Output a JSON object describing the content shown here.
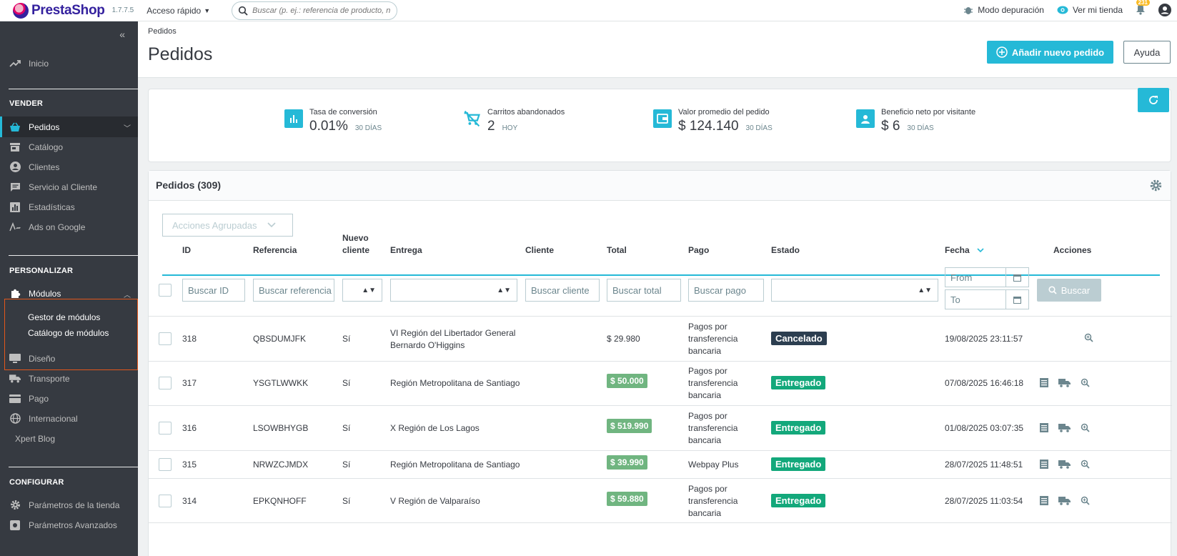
{
  "topbar": {
    "brand": "PrestaShop",
    "version": "1.7.7.5",
    "quick_access": "Acceso rápido",
    "search_placeholder": "Buscar (p. ej.: referencia de producto, n",
    "debug_mode": "Modo depuración",
    "view_store": "Ver mi tienda",
    "notifications_count": "231"
  },
  "sidebar": {
    "home": "Inicio",
    "section_sell": "VENDER",
    "orders": "Pedidos",
    "catalog": "Catálogo",
    "customers": "Clientes",
    "customer_service": "Servicio al Cliente",
    "stats": "Estadísticas",
    "ads": "Ads on Google",
    "section_customize": "PERSONALIZAR",
    "modules": "Módulos",
    "module_manager": "Gestor de módulos",
    "module_catalog": "Catálogo de módulos",
    "design": "Diseño",
    "shipping": "Transporte",
    "payment": "Pago",
    "international": "Internacional",
    "xpert_blog": "Xpert Blog",
    "section_configure": "CONFIGURAR",
    "shop_params": "Parámetros de la tienda",
    "advanced_params": "Parámetros Avanzados"
  },
  "header": {
    "breadcrumb": "Pedidos",
    "title": "Pedidos",
    "add_button": "Añadir nuevo pedido",
    "help_button": "Ayuda"
  },
  "kpis": [
    {
      "label": "Tasa de conversión",
      "value": "0.01%",
      "period": "30 DÍAS"
    },
    {
      "label": "Carritos abandonados",
      "value": "2",
      "period": "HOY"
    },
    {
      "label": "Valor promedio del pedido",
      "value": "$ 124.140",
      "period": "30 DÍAS"
    },
    {
      "label": "Beneficio neto por visitante",
      "value": "$ 6",
      "period": "30 DÍAS"
    }
  ],
  "orders": {
    "title": "Pedidos (309)",
    "bulk_actions": "Acciones Agrupadas",
    "columns": {
      "id": "ID",
      "reference": "Referencia",
      "new_customer_1": "Nuevo",
      "new_customer_2": "cliente",
      "delivery": "Entrega",
      "customer": "Cliente",
      "total": "Total",
      "payment": "Pago",
      "status": "Estado",
      "date": "Fecha",
      "actions": "Acciones"
    },
    "filters": {
      "id": "Buscar ID",
      "reference": "Buscar referencia",
      "customer": "Buscar cliente",
      "total": "Buscar total",
      "payment": "Buscar pago",
      "from": "From",
      "to": "To",
      "search_button": "Buscar"
    },
    "rows": [
      {
        "id": "318",
        "reference": "QBSDUMJFK",
        "new": "Sí",
        "delivery_1": "VI Región del Libertador General",
        "delivery_2": "Bernardo O'Higgins",
        "total": "$ 29.980",
        "pay_1": "Pagos por",
        "pay_2": "transferencia",
        "pay_3": "bancaria",
        "status": "Cancelado",
        "date": "19/08/2025 23:11:57"
      },
      {
        "id": "317",
        "reference": "YSGTLWWKK",
        "new": "Sí",
        "delivery_1": "Región Metropolitana de Santiago",
        "delivery_2": "",
        "total": "$ 50.000",
        "pay_1": "Pagos por",
        "pay_2": "transferencia",
        "pay_3": "bancaria",
        "status": "Entregado",
        "date": "07/08/2025 16:46:18"
      },
      {
        "id": "316",
        "reference": "LSOWBHYGB",
        "new": "Sí",
        "delivery_1": "X Región de Los Lagos",
        "delivery_2": "",
        "total": "$ 519.990",
        "pay_1": "Pagos por",
        "pay_2": "transferencia",
        "pay_3": "bancaria",
        "status": "Entregado",
        "date": "01/08/2025 03:07:35"
      },
      {
        "id": "315",
        "reference": "NRWZCJMDX",
        "new": "Sí",
        "delivery_1": "Región Metropolitana de Santiago",
        "delivery_2": "",
        "total": "$ 39.990",
        "pay_1": "Webpay Plus",
        "pay_2": "",
        "pay_3": "",
        "status": "Entregado",
        "date": "28/07/2025 11:48:51"
      },
      {
        "id": "314",
        "reference": "EPKQNHOFF",
        "new": "Sí",
        "delivery_1": "V Región de Valparaíso",
        "delivery_2": "",
        "total": "$ 59.880",
        "pay_1": "Pagos por",
        "pay_2": "transferencia",
        "pay_3": "bancaria",
        "status": "Entregado",
        "date": "28/07/2025 11:03:54"
      }
    ]
  },
  "colors": {
    "accent": "#25b9d7",
    "sidebar": "#363a41",
    "delivered": "#13a87b",
    "cancelled": "#2c3e50",
    "total_badge": "#70b580"
  }
}
